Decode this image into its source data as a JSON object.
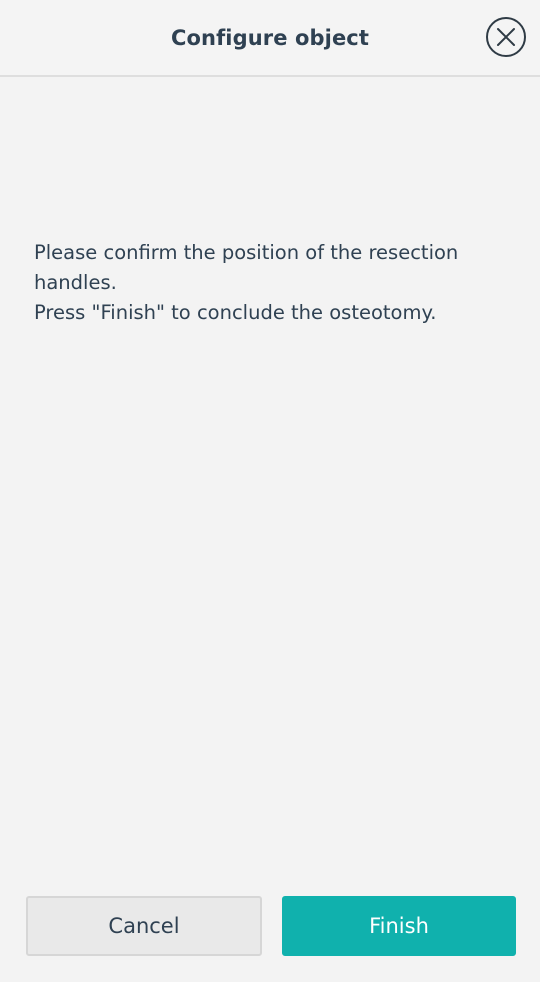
{
  "header": {
    "title": "Configure object",
    "close_icon": "close-circle-icon"
  },
  "message": {
    "lines": [
      "Please confirm the position of the resection",
      "handles.",
      "Press \"Finish\" to conclude the osteotomy."
    ]
  },
  "actions": {
    "cancel_label": "Cancel",
    "finish_label": "Finish"
  },
  "colors": {
    "background": "#f3f3f3",
    "text": "#2f4152",
    "accent": "#10b1ad",
    "secondary_button": "#e9e9e9"
  }
}
